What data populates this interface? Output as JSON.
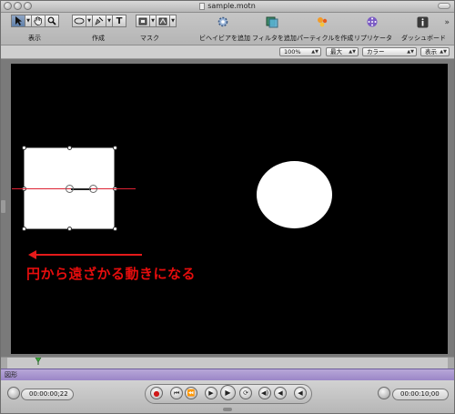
{
  "window": {
    "title": "sample.motn"
  },
  "toolbar": {
    "groups": [
      {
        "label": "表示"
      },
      {
        "label": "作成"
      },
      {
        "label": "マスク"
      }
    ],
    "actions": [
      {
        "label": "ビヘイビアを追加",
        "icon": "gear-icon"
      },
      {
        "label": "フィルタを追加",
        "icon": "filter-icon"
      },
      {
        "label": "パーティクルを作成",
        "icon": "particle-icon"
      },
      {
        "label": "リプリケータ",
        "icon": "replicator-icon"
      },
      {
        "label": "ダッシュボード",
        "icon": "info-icon"
      }
    ],
    "overflow": "»"
  },
  "view_options": {
    "zoom": "100%",
    "resolution": "最大",
    "channel": "カラー",
    "display": "表示"
  },
  "canvas": {
    "annotation": "円から遠ざかる動きになる"
  },
  "timeline": {
    "lane_label": "図形"
  },
  "transport": {
    "current_time": "00:00:00;22",
    "duration": "00:00:10;00",
    "buttons": [
      "record",
      "to-start",
      "step-back",
      "play-from-start",
      "play",
      "loop",
      "audio",
      "prev-frame",
      "next-frame",
      "to-end"
    ]
  }
}
